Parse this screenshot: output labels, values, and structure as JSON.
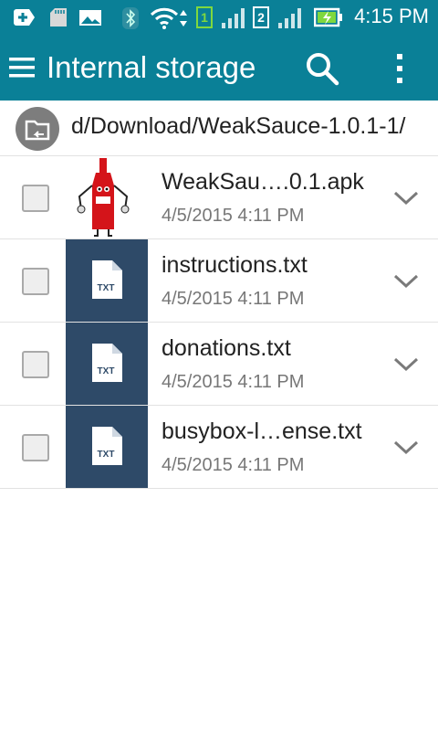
{
  "status_bar": {
    "time": "4:15 PM",
    "sim1": "1",
    "sim2": "2"
  },
  "app_bar": {
    "title": "Internal storage"
  },
  "path_bar": {
    "path": "d/Download/WeakSauce-1.0.1-1/"
  },
  "files": [
    {
      "name": "WeakSau….0.1.apk",
      "date": "4/5/2015 4:11 PM",
      "icon": "apk-bottle-icon"
    },
    {
      "name": "instructions.txt",
      "date": "4/5/2015 4:11 PM",
      "icon": "txt-file-icon",
      "icon_label": "TXT"
    },
    {
      "name": "donations.txt",
      "date": "4/5/2015 4:11 PM",
      "icon": "txt-file-icon",
      "icon_label": "TXT"
    },
    {
      "name": "busybox-l…ense.txt",
      "date": "4/5/2015 4:11 PM",
      "icon": "txt-file-icon",
      "icon_label": "TXT"
    }
  ],
  "colors": {
    "app_bar": "#0a8097",
    "txt_thumb": "#2e4a68"
  }
}
